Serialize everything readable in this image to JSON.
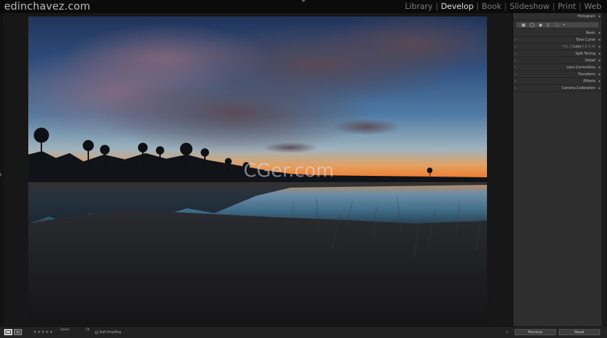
{
  "app": {
    "brand": "edinchavez.com",
    "watermark": "CGer.com"
  },
  "modules": [
    {
      "label": "Library",
      "active": false
    },
    {
      "label": "Develop",
      "active": true
    },
    {
      "label": "Book",
      "active": false
    },
    {
      "label": "Slideshow",
      "active": false
    },
    {
      "label": "Print",
      "active": false
    },
    {
      "label": "Web",
      "active": false
    }
  ],
  "right_panel": {
    "histogram": "Histogram",
    "basic": "Basic",
    "tone_curve": "Tone Curve",
    "hsl": "HSL",
    "color": "Color",
    "bw": "B & W",
    "split_toning": "Split Toning",
    "detail": "Detail",
    "lens_corrections": "Lens Corrections",
    "transform": "Transform",
    "effects": "Effects",
    "camera_calibration": "Camera Calibration"
  },
  "bottom": {
    "stars": "★★★★★",
    "zoom_label": "Zoom",
    "fit_label": "Fit",
    "soft_proofing": "Soft Proofing",
    "previous": "Previous",
    "reset": "Reset"
  },
  "colors": {
    "panel_bg": "#2e2e2e",
    "topbar_bg": "#0b0b0b",
    "active_module": "#e0e0e0",
    "inactive_module": "#7b7b7b"
  }
}
